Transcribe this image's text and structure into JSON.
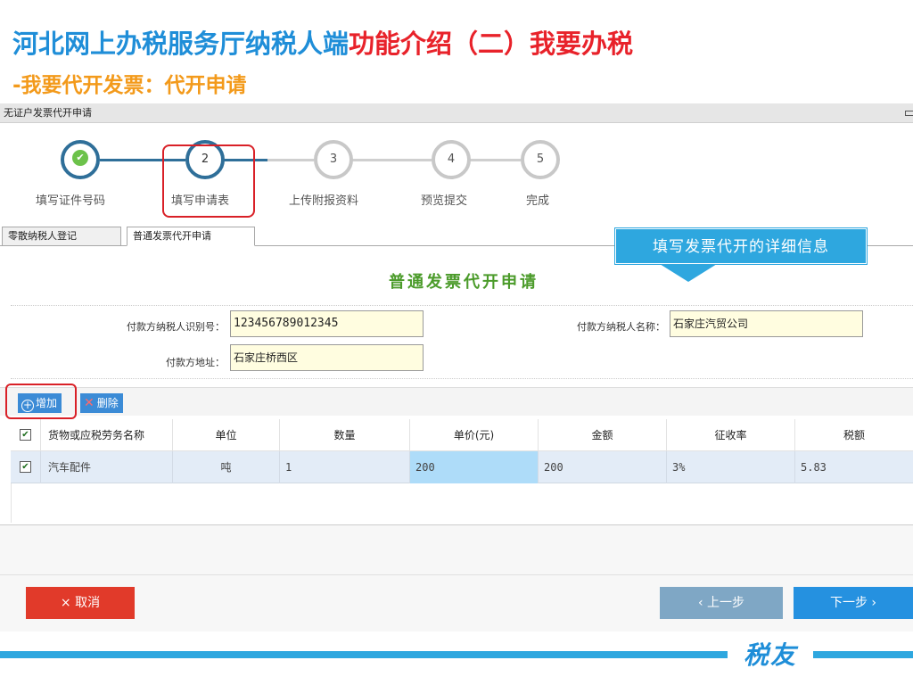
{
  "slide": {
    "title_part1": "河北网上办税服务厅纳税人端",
    "title_part2": "功能介绍（二）我要办税",
    "subtitle": "-我要代开发票：代开申请",
    "brand": "税友"
  },
  "window": {
    "title": "无证户发票代开申请"
  },
  "steps": [
    {
      "number": "✔",
      "label": "填写证件号码",
      "status": "done"
    },
    {
      "number": "2",
      "label": "填写申请表",
      "status": "active"
    },
    {
      "number": "3",
      "label": "上传附报资料",
      "status": "todo"
    },
    {
      "number": "4",
      "label": "预览提交",
      "status": "todo"
    },
    {
      "number": "5",
      "label": "完成",
      "status": "todo"
    }
  ],
  "tabs": [
    {
      "label": "零散纳税人登记",
      "active": false
    },
    {
      "label": "普通发票代开申请",
      "active": true
    }
  ],
  "callout": {
    "text": "填写发票代开的详细信息",
    "color": "#2ea7df"
  },
  "form": {
    "title": "普通发票代开申请",
    "payer_tax_id_label": "付款方纳税人识别号：",
    "payer_tax_id_value": "123456789012345",
    "payer_name_label": "付款方纳税人名称：",
    "payer_name_value": "石家庄汽贸公司",
    "payer_address_label": "付款方地址：",
    "payer_address_value": "石家庄桥西区"
  },
  "toolbar": {
    "add_label": "增加",
    "delete_label": "删除"
  },
  "table": {
    "columns": [
      "货物或应税劳务名称",
      "单位",
      "数量",
      "单价(元)",
      "金额",
      "征收率",
      "税额"
    ],
    "rows": [
      {
        "checked": true,
        "name": "汽车配件",
        "unit": "吨",
        "quantity": "1",
        "unit_price": "200",
        "amount": "200",
        "rate": "3%",
        "tax": "5.83"
      }
    ]
  },
  "footer": {
    "cancel_label": "× 取消",
    "prev_label": "‹ 上一步",
    "next_label": "下一步 ›"
  },
  "colors": {
    "title_blue": "#1f8ed8",
    "title_red": "#e8222a",
    "subtitle_orange": "#f39a1b",
    "step_blue": "#2f6f99",
    "cancel_red": "#e13a2a",
    "next_blue": "#2591e0"
  }
}
